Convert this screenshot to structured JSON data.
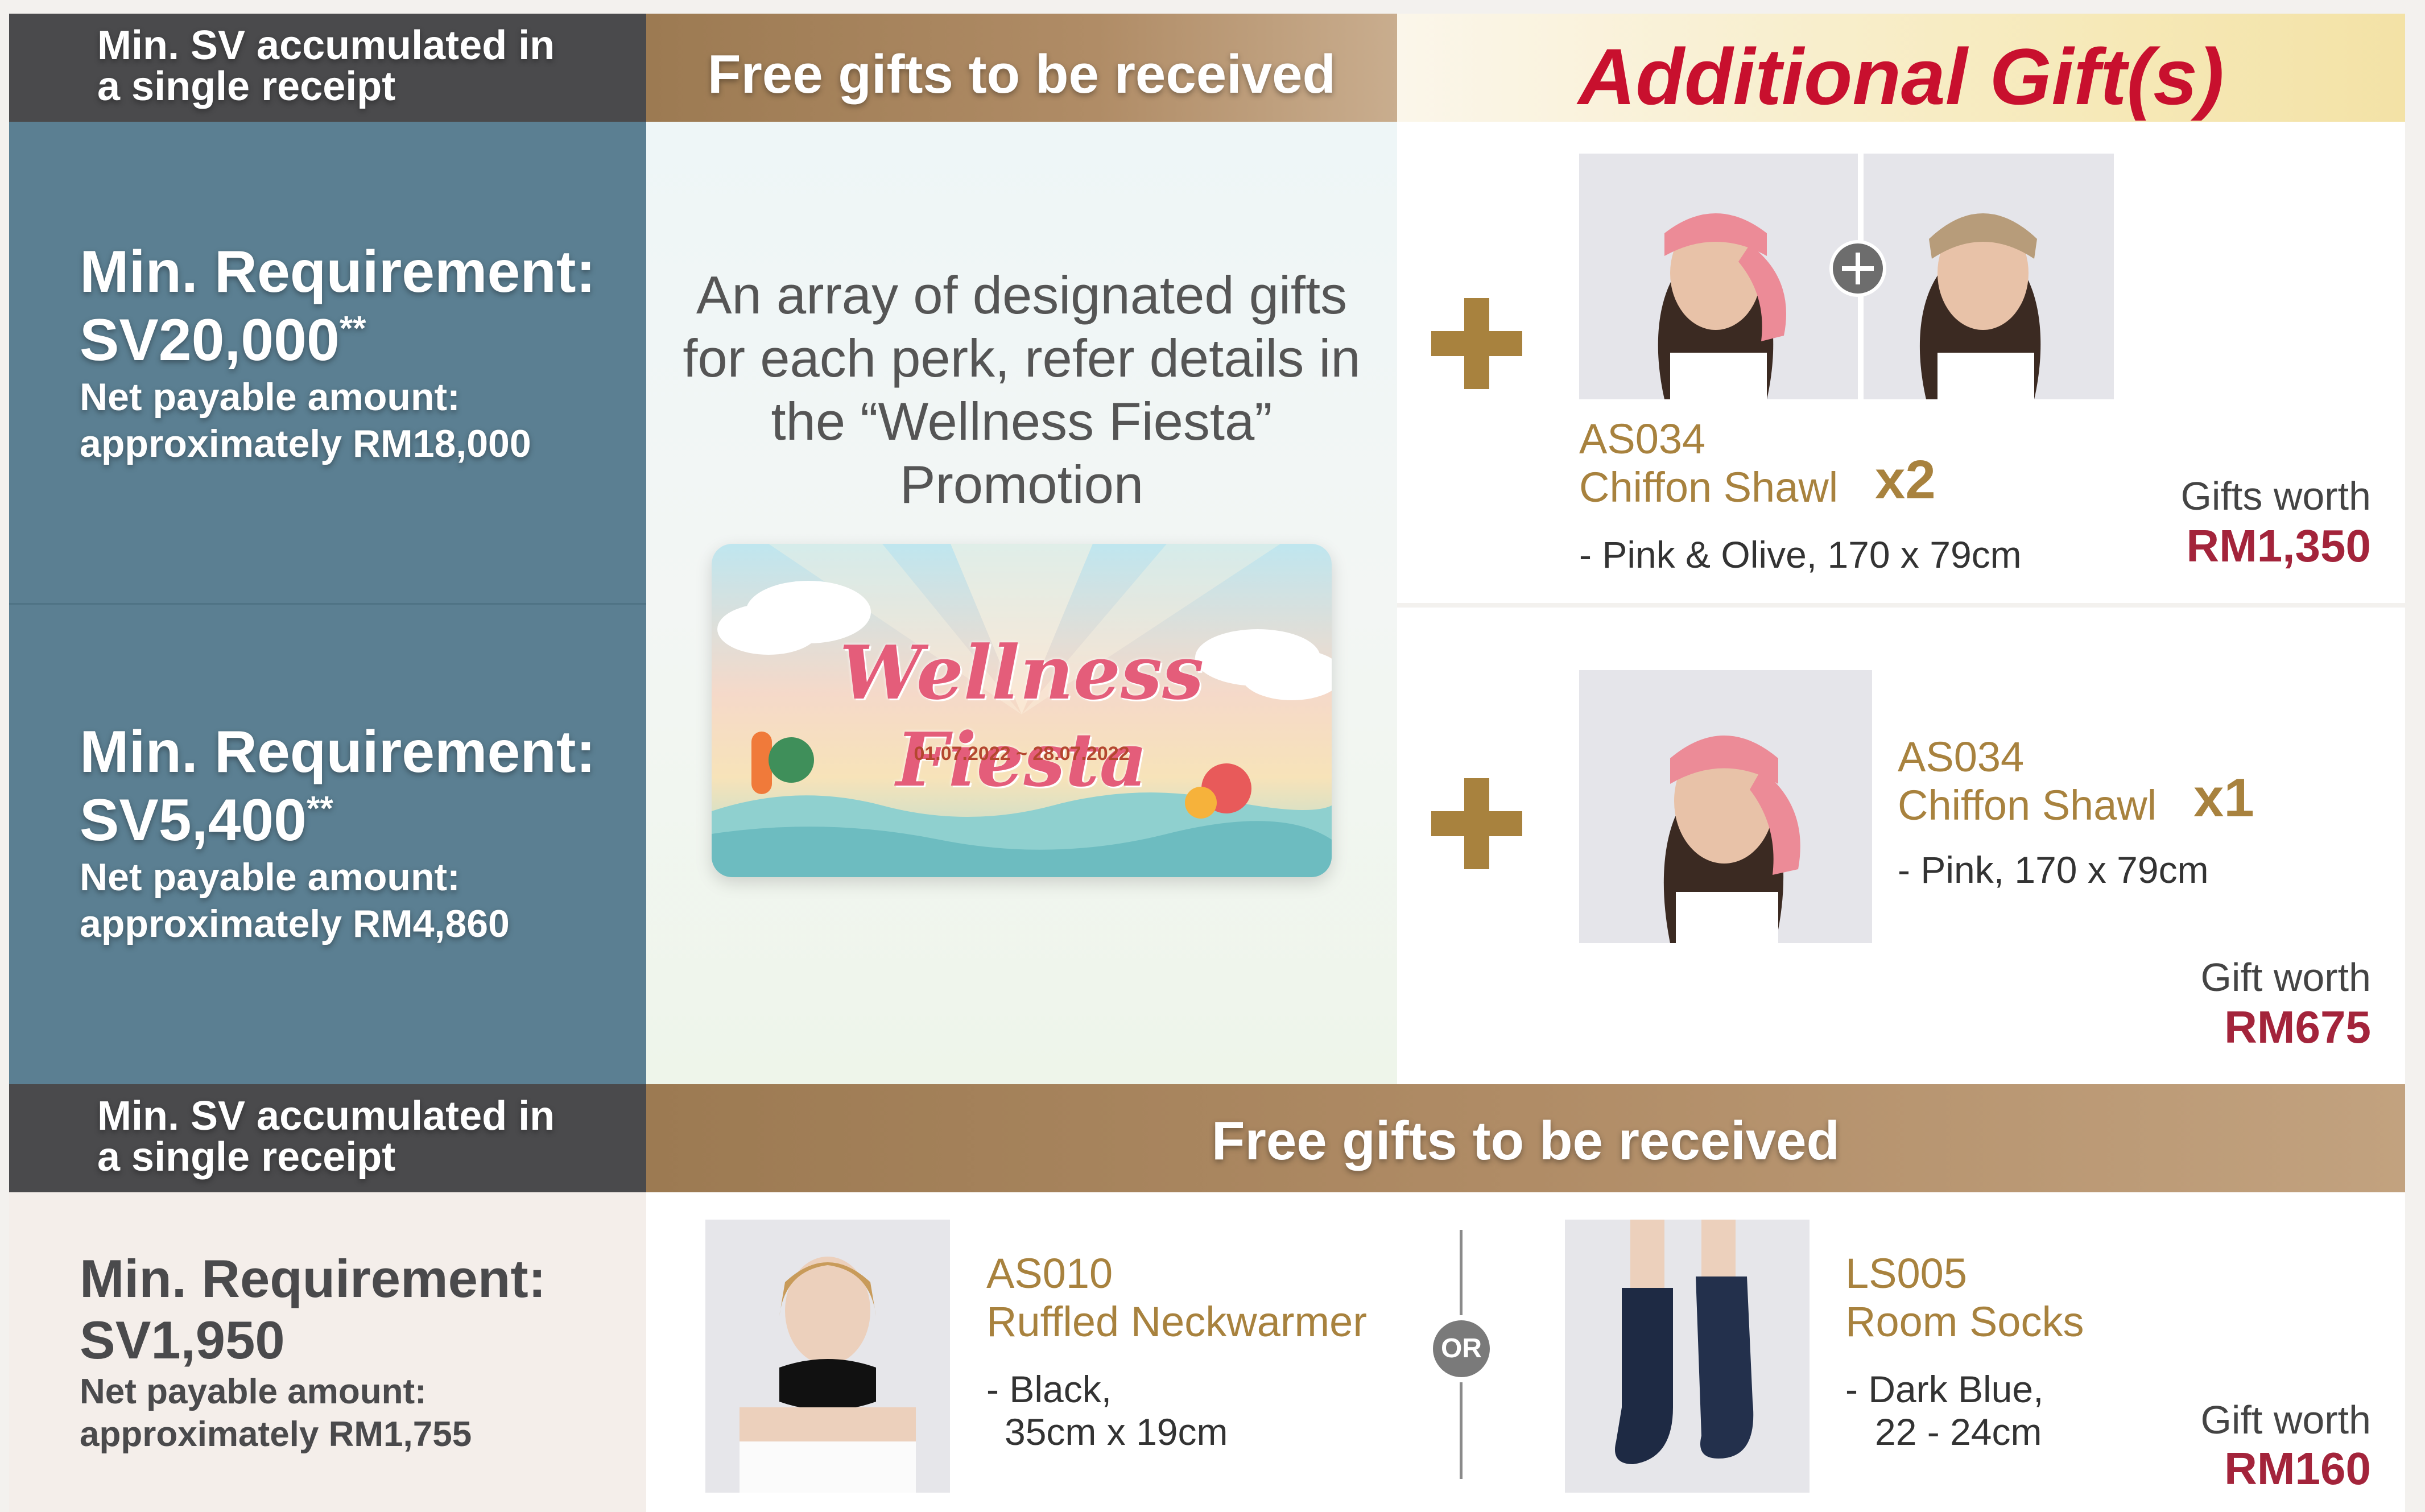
{
  "header_top": {
    "col1": "Min. SV accumulated in a single receipt",
    "col2": "Free gifts to be received",
    "col3": "Additional Gift(s)"
  },
  "tier1": {
    "title": "Min. Requirement:",
    "sv": "SV20,000",
    "sup": "**",
    "net_label": "Net payable amount:",
    "net_value": "approximately RM18,000",
    "item_code": "AS034",
    "item_name": "Chiffon Shawl",
    "mult": "x2",
    "spec": "- Pink & Olive, 170 x 79cm",
    "worth_label": "Gifts worth",
    "worth_value": "RM1,350"
  },
  "tier2": {
    "title": "Min. Requirement:",
    "sv": "SV5,400",
    "sup": "**",
    "net_label": "Net payable amount:",
    "net_value": "approximately RM4,860",
    "item_code": "AS034",
    "item_name": "Chiffon Shawl",
    "mult": "x1",
    "spec": "- Pink, 170 x 79cm",
    "worth_label": "Gift worth",
    "worth_value": "RM675"
  },
  "center": {
    "text": "An array of designated gifts for each perk, refer details in the “Wellness Fiesta” Promotion",
    "banner_title": "Wellness Fiesta",
    "banner_date": "01.07.2022 ~ 28.07.2022"
  },
  "header_bottom": {
    "col1": "Min. SV accumulated in a single receipt",
    "col2": "Free gifts to be received"
  },
  "tier3": {
    "title": "Min. Requirement:",
    "sv": "SV1,950",
    "net_label": "Net payable amount:",
    "net_value": "approximately RM1,755",
    "item1_code": "AS010",
    "item1_name": "Ruffled Neckwarmer",
    "item1_spec1": "- Black,",
    "item1_spec2": "35cm x 19cm",
    "or_label": "OR",
    "item2_code": "LS005",
    "item2_name": "Room Socks",
    "item2_spec1": "- Dark Blue,",
    "item2_spec2": "22 - 24cm",
    "worth_label": "Gift worth",
    "worth_value": "RM160"
  },
  "colors": {
    "teal": "#5b7f92",
    "gold": "#a8823e",
    "red": "#a3243b",
    "dark": "#4a4a4c"
  }
}
